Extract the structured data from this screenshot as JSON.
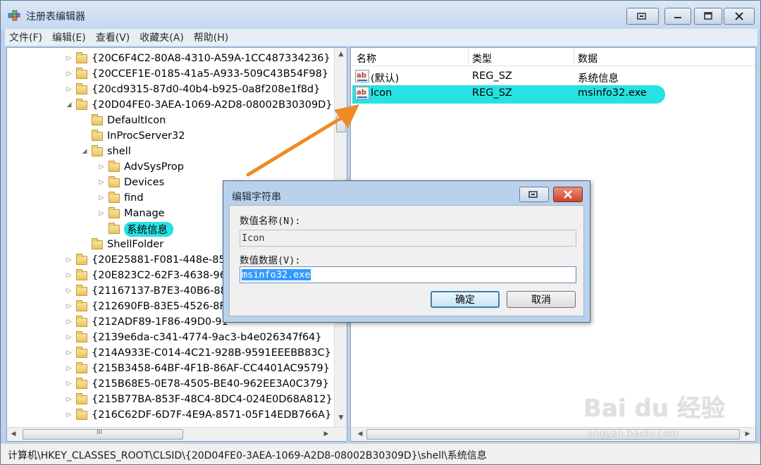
{
  "window": {
    "title": "注册表编辑器",
    "menu": [
      "文件(F)",
      "编辑(E)",
      "查看(V)",
      "收藏夹(A)",
      "帮助(H)"
    ]
  },
  "tree": {
    "items": [
      {
        "label": "{20C6F4C2-80A8-4310-A59A-1CC487334236}",
        "level": 0,
        "arrow": "closed",
        "selected": false
      },
      {
        "label": "{20CCEF1E-0185-41a5-A933-509C43B54F98}",
        "level": 0,
        "arrow": "closed",
        "selected": false
      },
      {
        "label": "{20cd9315-87d0-40b4-b925-0a8f208e1f8d}",
        "level": 0,
        "arrow": "closed",
        "selected": false
      },
      {
        "label": "{20D04FE0-3AEA-1069-A2D8-08002B30309D}",
        "level": 0,
        "arrow": "open",
        "selected": false
      },
      {
        "label": "DefaultIcon",
        "level": 1,
        "arrow": "none",
        "selected": false
      },
      {
        "label": "InProcServer32",
        "level": 1,
        "arrow": "none",
        "selected": false
      },
      {
        "label": "shell",
        "level": 1,
        "arrow": "open",
        "selected": false
      },
      {
        "label": "AdvSysProp",
        "level": 2,
        "arrow": "closed",
        "selected": false
      },
      {
        "label": "Devices",
        "level": 2,
        "arrow": "closed",
        "selected": false
      },
      {
        "label": "find",
        "level": 2,
        "arrow": "closed",
        "selected": false
      },
      {
        "label": "Manage",
        "level": 2,
        "arrow": "closed",
        "selected": false
      },
      {
        "label": "系统信息",
        "level": 2,
        "arrow": "none",
        "selected": true
      },
      {
        "label": "ShellFolder",
        "level": 1,
        "arrow": "none",
        "selected": false
      },
      {
        "label": "{20E25881-F081-448e-856",
        "level": 0,
        "arrow": "closed",
        "selected": false
      },
      {
        "label": "{20E823C2-62F3-4638-96",
        "level": 0,
        "arrow": "closed",
        "selected": false
      },
      {
        "label": "{21167137-B7E3-40B6-88",
        "level": 0,
        "arrow": "closed",
        "selected": false
      },
      {
        "label": "{212690FB-83E5-4526-8F",
        "level": 0,
        "arrow": "closed",
        "selected": false
      },
      {
        "label": "{212ADF89-1F86-49D0-91",
        "level": 0,
        "arrow": "closed",
        "selected": false
      },
      {
        "label": "{2139e6da-c341-4774-9ac3-b4e026347f64}",
        "level": 0,
        "arrow": "closed",
        "selected": false
      },
      {
        "label": "{214A933E-C014-4C21-928B-9591EEEBB83C}",
        "level": 0,
        "arrow": "closed",
        "selected": false
      },
      {
        "label": "{215B3458-64BF-4F1B-86AF-CC4401AC9579}",
        "level": 0,
        "arrow": "closed",
        "selected": false
      },
      {
        "label": "{215B68E5-0E78-4505-BE40-962EE3A0C379}",
        "level": 0,
        "arrow": "closed",
        "selected": false
      },
      {
        "label": "{215B77BA-853F-48C4-8DC4-024E0D68A812}",
        "level": 0,
        "arrow": "closed",
        "selected": false
      },
      {
        "label": "{216C62DF-6D7F-4E9A-8571-05F14EDB766A}",
        "level": 0,
        "arrow": "closed",
        "selected": false
      }
    ]
  },
  "values": {
    "headers": {
      "name": "名称",
      "type": "类型",
      "data": "数据"
    },
    "rows": [
      {
        "name": "(默认)",
        "type": "REG_SZ",
        "data": "系统信息",
        "selected": false
      },
      {
        "name": "Icon",
        "type": "REG_SZ",
        "data": "msinfo32.exe",
        "selected": true
      }
    ]
  },
  "statusbar": {
    "path": "计算机\\HKEY_CLASSES_ROOT\\CLSID\\{20D04FE0-3AEA-1069-A2D8-08002B30309D}\\shell\\系统信息"
  },
  "dialog": {
    "title": "编辑字符串",
    "name_label": "数值名称(N):",
    "name_value": "Icon",
    "data_label": "数值数据(V):",
    "data_value": "msinfo32.exe",
    "ok_label": "确定",
    "cancel_label": "取消"
  },
  "scroll_labels": {
    "up": "▲",
    "down": "▼",
    "left": "◀",
    "right": "▶",
    "grip": "III"
  },
  "watermark": {
    "brand": "Bai du 经验",
    "url": "jingyan.baidu.com"
  },
  "colors": {
    "highlight": "#27e1e3",
    "arrow": "#f08a24",
    "selection": "#3399ff"
  }
}
